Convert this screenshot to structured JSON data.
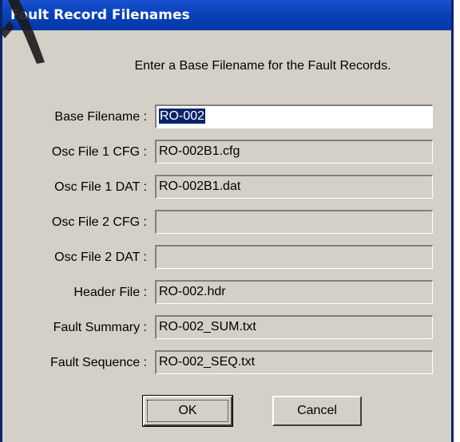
{
  "window": {
    "title": "Fault Record Filenames"
  },
  "instruction": "Enter a Base Filename for the Fault Records.",
  "fields": [
    {
      "label": "Base Filename :",
      "value": "RO-002",
      "editable": true
    },
    {
      "label": "Osc File 1 CFG :",
      "value": "RO-002B1.cfg",
      "editable": false
    },
    {
      "label": "Osc File 1 DAT :",
      "value": "RO-002B1.dat",
      "editable": false
    },
    {
      "label": "Osc File 2 CFG :",
      "value": "",
      "editable": false
    },
    {
      "label": "Osc File 2 DAT :",
      "value": "",
      "editable": false
    },
    {
      "label": "Header File :",
      "value": "RO-002.hdr",
      "editable": false
    },
    {
      "label": "Fault Summary :",
      "value": "RO-002_SUM.txt",
      "editable": false
    },
    {
      "label": "Fault Sequence :",
      "value": "RO-002_SEQ.txt",
      "editable": false
    }
  ],
  "buttons": {
    "ok_label": "OK",
    "cancel_label": "Cancel"
  },
  "colors": {
    "titlebar": "#0842b8",
    "dialog_bg": "#d4d0c8",
    "selection": "#0a246a"
  }
}
